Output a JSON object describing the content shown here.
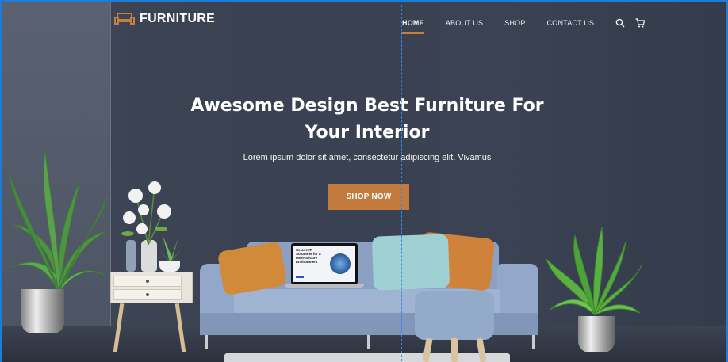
{
  "brand": {
    "name": "FURNITURE",
    "accent": "#c47f3e"
  },
  "nav": {
    "items": [
      "HOME",
      "ABOUT US",
      "SHOP",
      "CONTACT US"
    ],
    "active": "HOME",
    "icons": [
      "search-icon",
      "cart-icon"
    ]
  },
  "hero": {
    "title_line1": "Awesome Design Best Furniture For",
    "title_line2": "Your Interior",
    "subtitle": "Lorem ipsum dolor sit amet, consectetur adipiscing elit. Vivamus",
    "cta_label": "SHOP NOW"
  },
  "laptop_screen": {
    "title": "Secure IT Solutions for a More Secure Environment"
  },
  "colors": {
    "wall": "#394152",
    "button": "#c27b3c",
    "guide": "#2e8ae6"
  }
}
